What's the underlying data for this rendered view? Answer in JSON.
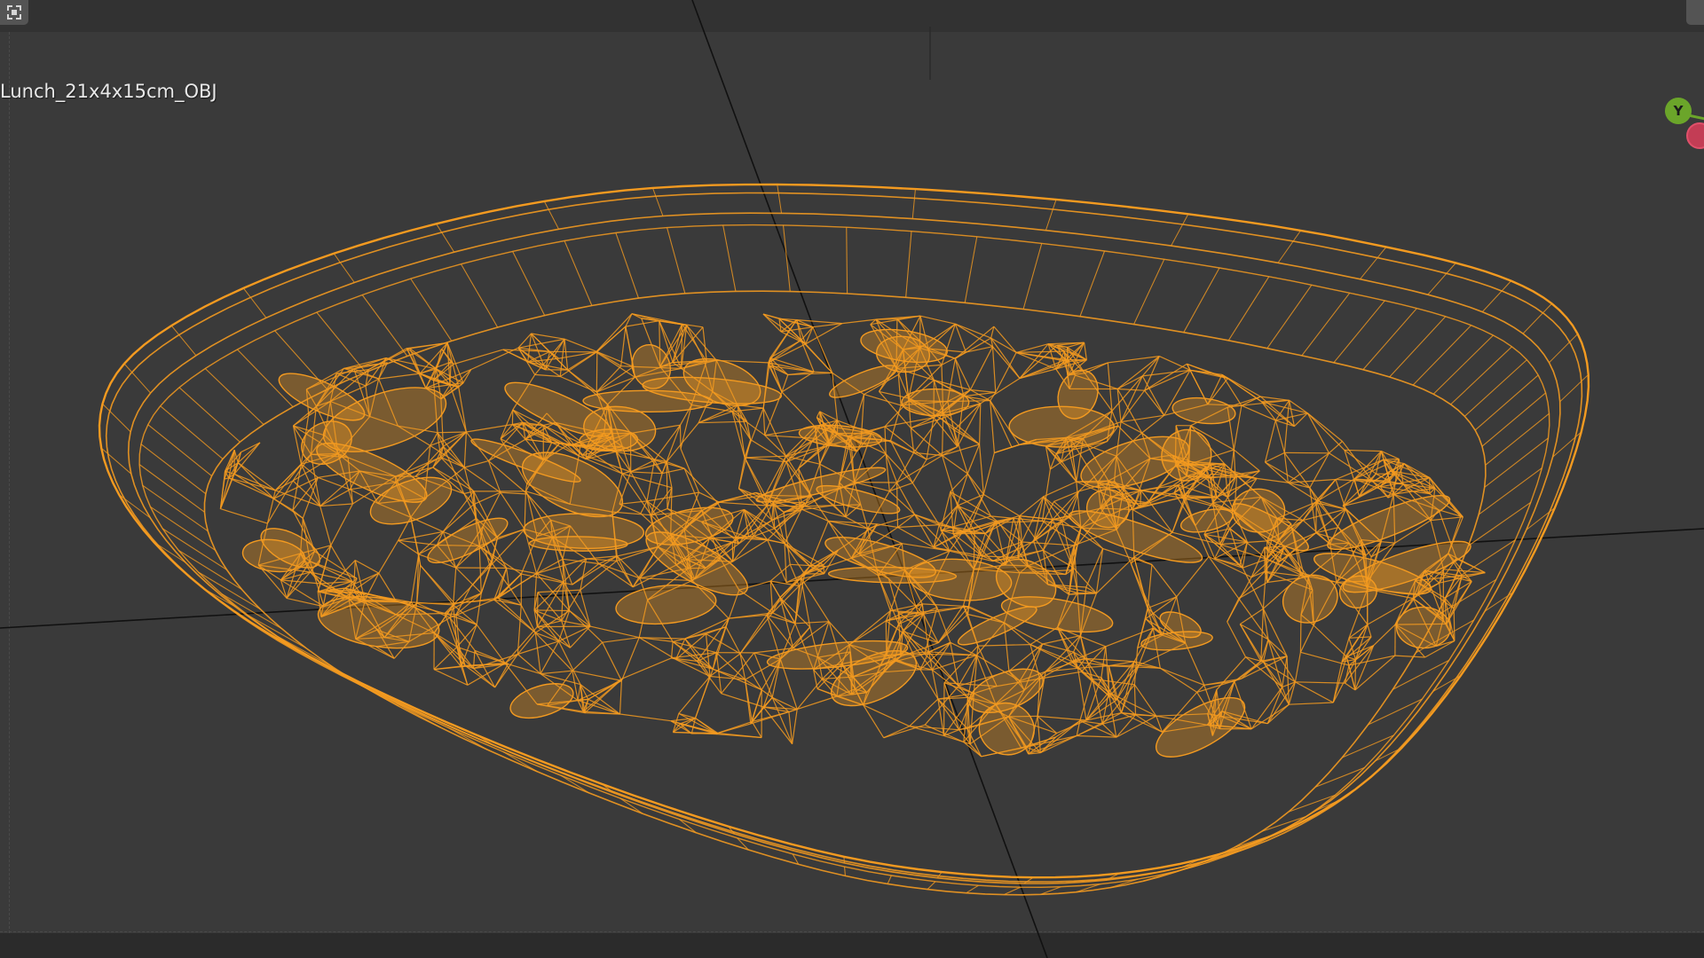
{
  "viewport": {
    "object_label": "Lunch_21x4x15cm_OBJ",
    "background_color": "#3a3a3a",
    "wire_color": "#f39a20",
    "grid_line_color": "#111111"
  },
  "header": {
    "select_box_icon": "select-box-icon",
    "top_right_icon": "menu-icon"
  },
  "gizmo": {
    "y_label": "Y",
    "x_label": "",
    "y_color": "#6ba52a",
    "x_color": "#c33d55"
  }
}
